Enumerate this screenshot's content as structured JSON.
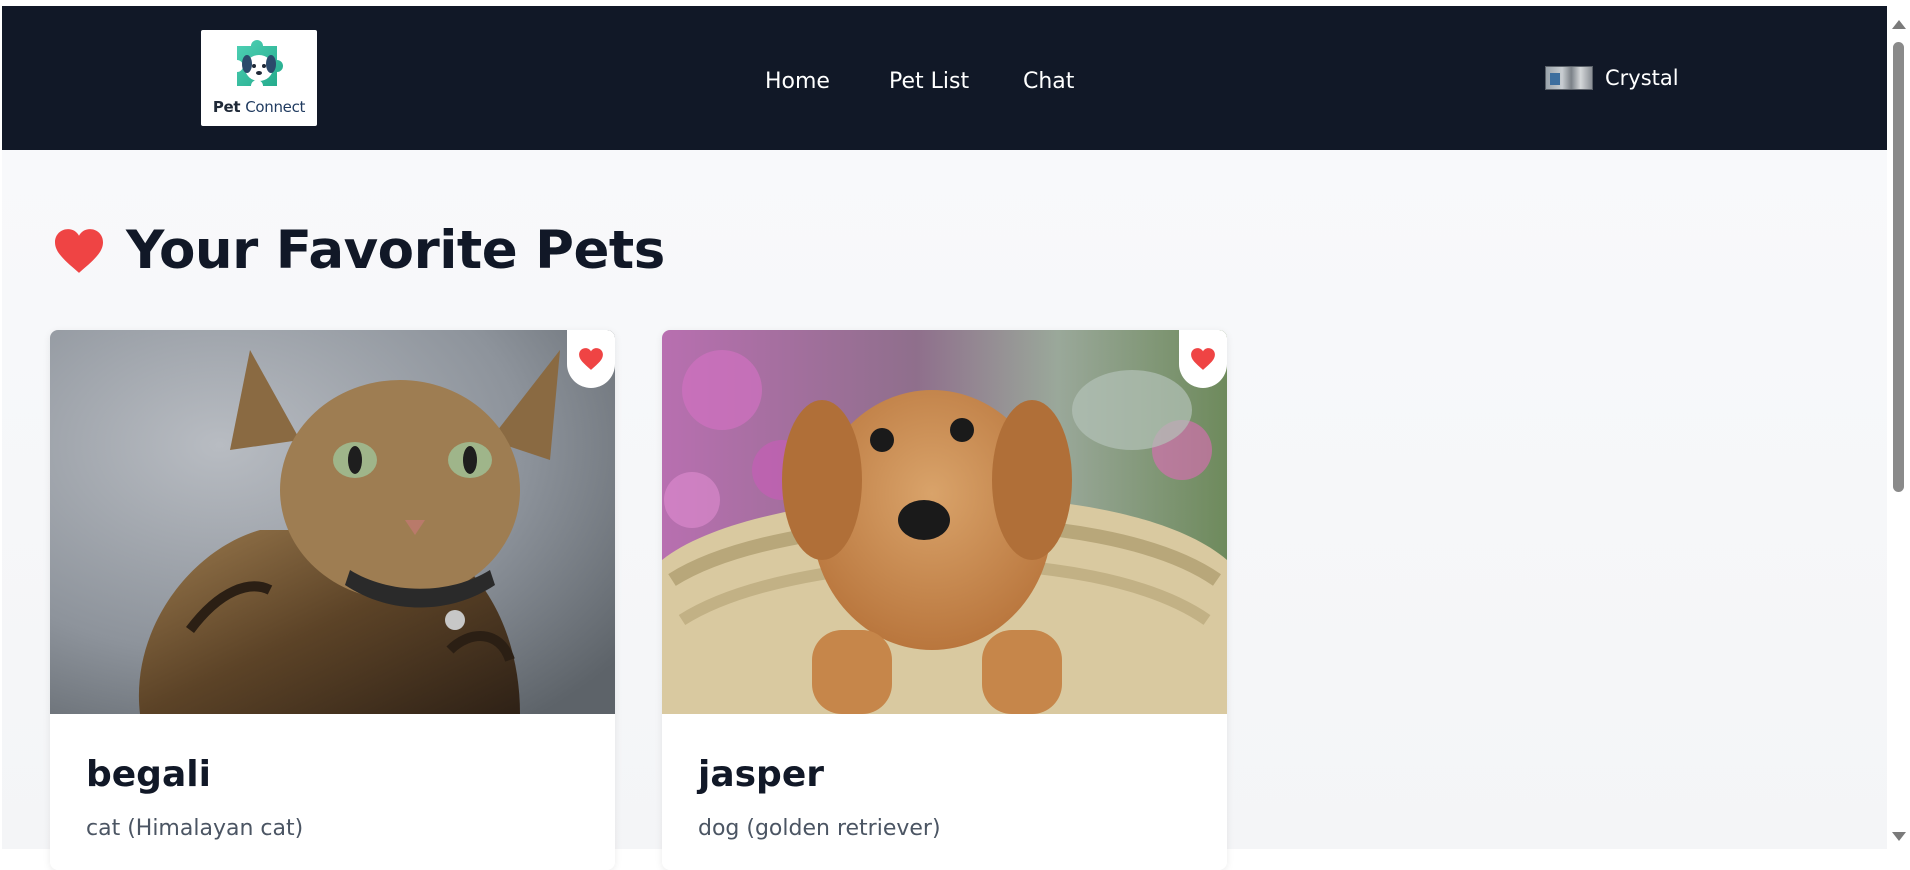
{
  "header": {
    "logo": {
      "line1": "Pet",
      "line2": "Connect"
    },
    "nav": [
      {
        "label": "Home"
      },
      {
        "label": "Pet List"
      },
      {
        "label": "Chat"
      }
    ],
    "user": {
      "name": "Crystal"
    }
  },
  "main": {
    "title": "Your Favorite Pets",
    "title_icon": "heart-icon",
    "pets": [
      {
        "name": "begali",
        "type": "cat (Himalayan cat)",
        "favorited": true,
        "image": "tabby-cat-photo"
      },
      {
        "name": "jasper",
        "type": "dog (golden retriever)",
        "favorited": true,
        "image": "golden-retriever-puppy-photo"
      }
    ]
  },
  "colors": {
    "navbar": "#111827",
    "heart": "#ef4444",
    "title": "#111827",
    "subtext": "#4b5563"
  }
}
